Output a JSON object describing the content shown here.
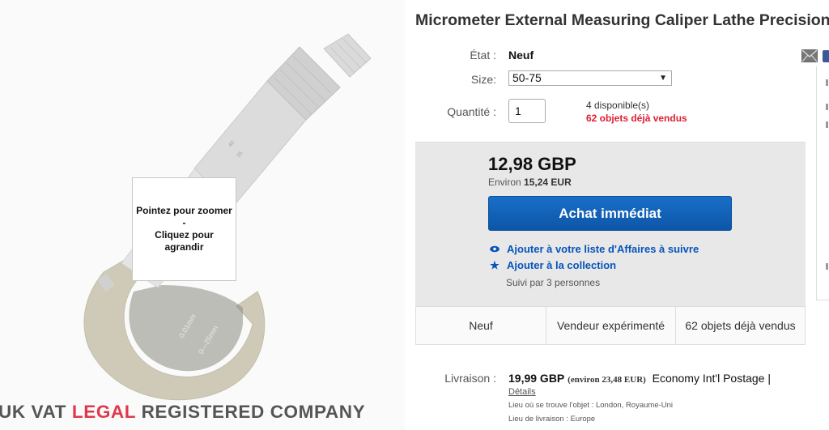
{
  "image_panel": {
    "zoom_hint": {
      "line1": "Pointez pour zoomer",
      "line2": "-",
      "line3": "Cliquez pour",
      "line4": "agrandir"
    },
    "watermark_left": "UK VAT ",
    "watermark_red": "LEGAL",
    "watermark_right": " REGISTERED COMPANY"
  },
  "listing": {
    "title": "Micrometer External Measuring Caliper Lathe Precision",
    "condition_label": "État :",
    "condition_value": "Neuf",
    "size_label": "Size:",
    "size_selected": "50-75",
    "quantity_label": "Quantité :",
    "quantity_value": "1",
    "available": "4 disponible(s)",
    "sold": "62 objets déjà vendus"
  },
  "price_box": {
    "price": "12,98 GBP",
    "approx_prefix": "Environ ",
    "approx_value": "15,24 EUR",
    "buy_button": "Achat immédiat",
    "watch_link": "Ajouter à votre liste d'Affaires à suivre",
    "collection_link": "Ajouter à la collection",
    "followers": "Suivi par 3 personnes"
  },
  "badges": [
    "Neuf",
    "Vendeur expérimenté",
    "62 objets déjà vendus"
  ],
  "shipping": {
    "label": "Livraison :",
    "price": "19,99 GBP",
    "approx": "(environ 23,48 EUR)",
    "service": "Economy Int'l Postage |",
    "details_link": "Détails",
    "item_location": "Lieu où se trouve l'objet :  London, Royaume-Uni",
    "delivery_area": "Lieu de livraison :  Europe"
  },
  "colors": {
    "buy_button": "#0f5fb8",
    "link": "#0654ba",
    "sold_red": "#dd1e31",
    "watermark_red": "#e0384b"
  },
  "icons": [
    "eye-icon",
    "star-icon",
    "mail-icon",
    "chevron-down-icon"
  ]
}
